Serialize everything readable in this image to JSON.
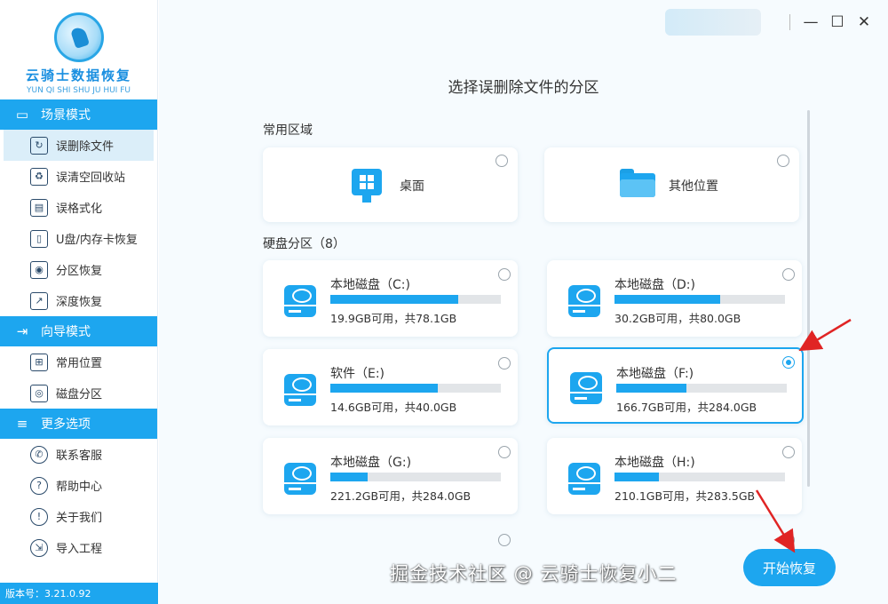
{
  "app": {
    "name": "云骑士数据恢复",
    "name_pinyin": "YUN QI SHI SHU JU HUI FU",
    "version_label": "版本号：3.21.0.92"
  },
  "sidebar": {
    "sections": [
      {
        "title": "场景模式",
        "icon": "monitor-icon",
        "items": [
          {
            "label": "误删除文件",
            "icon": "recover-file-icon",
            "active": true
          },
          {
            "label": "误清空回收站",
            "icon": "recycle-bin-icon"
          },
          {
            "label": "误格式化",
            "icon": "format-disk-icon"
          },
          {
            "label": "U盘/内存卡恢复",
            "icon": "usb-drive-icon"
          },
          {
            "label": "分区恢复",
            "icon": "partition-icon"
          },
          {
            "label": "深度恢复",
            "icon": "deep-scan-icon"
          }
        ]
      },
      {
        "title": "向导模式",
        "icon": "signpost-icon",
        "items": [
          {
            "label": "常用位置",
            "icon": "windows-icon"
          },
          {
            "label": "磁盘分区",
            "icon": "disk-icon"
          }
        ]
      },
      {
        "title": "更多选项",
        "icon": "menu-icon",
        "items": [
          {
            "label": "联系客服",
            "icon": "phone-icon"
          },
          {
            "label": "帮助中心",
            "icon": "help-icon"
          },
          {
            "label": "关于我们",
            "icon": "info-icon"
          },
          {
            "label": "导入工程",
            "icon": "import-icon"
          }
        ]
      }
    ]
  },
  "window_controls": {
    "minimize": "—",
    "maximize": "☐",
    "close": "✕"
  },
  "main": {
    "title": "选择误删除文件的分区",
    "common_area_label": "常用区域",
    "common_areas": [
      {
        "label": "桌面",
        "icon": "desktop-icon",
        "selected": false
      },
      {
        "label": "其他位置",
        "icon": "folder-icon",
        "selected": false
      }
    ],
    "disk_section_label": "硬盘分区（8）",
    "disks": [
      {
        "name": "本地磁盘（C:)",
        "info": "19.9GB可用，共78.1GB",
        "used_fraction": 0.75,
        "selected": false
      },
      {
        "name": "本地磁盘（D:)",
        "info": "30.2GB可用，共80.0GB",
        "used_fraction": 0.62,
        "selected": false
      },
      {
        "name": "软件（E:)",
        "info": "14.6GB可用，共40.0GB",
        "used_fraction": 0.63,
        "selected": false
      },
      {
        "name": "本地磁盘（F:)",
        "info": "166.7GB可用，共284.0GB",
        "used_fraction": 0.41,
        "selected": true
      },
      {
        "name": "本地磁盘（G:)",
        "info": "221.2GB可用，共284.0GB",
        "used_fraction": 0.22,
        "selected": false
      },
      {
        "name": "本地磁盘（H:)",
        "info": "210.1GB可用，共283.5GB",
        "used_fraction": 0.26,
        "selected": false
      }
    ],
    "start_button": "开始恢复"
  },
  "watermark": "掘金技术社区 @ 云骑士恢复小二",
  "colors": {
    "accent": "#1da6ef",
    "annotation_arrow": "#e02424"
  }
}
